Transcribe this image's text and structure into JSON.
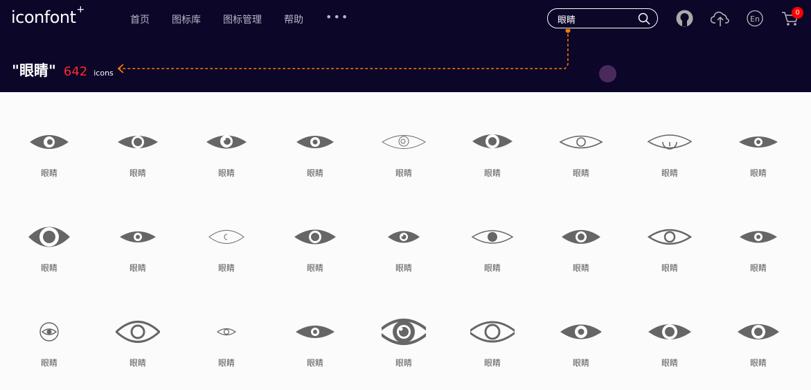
{
  "header": {
    "logo": "iconfont",
    "logo_sup": "+",
    "nav": [
      "首页",
      "图标库",
      "图标管理",
      "帮助"
    ],
    "nav_more": "•••",
    "search_value": "眼睛",
    "cart_count": "0",
    "icons": [
      "github-icon",
      "upload-cloud-icon",
      "language-en-icon",
      "cart-icon",
      "search-icon"
    ]
  },
  "results": {
    "query": "\"眼睛\"",
    "count": "642",
    "unit": "icons"
  },
  "colors": {
    "header_bg": "#0c0628",
    "accent": "#ff2a2a",
    "icon_gray": "#666666",
    "annotation": "#ff7a00"
  },
  "icon_grid": {
    "items": [
      {
        "label": "眼睛",
        "icon": "eye-icon"
      },
      {
        "label": "眼睛",
        "icon": "eye-icon"
      },
      {
        "label": "眼睛",
        "icon": "eye-icon"
      },
      {
        "label": "眼睛",
        "icon": "eye-icon"
      },
      {
        "label": "眼睛",
        "icon": "eye-icon"
      },
      {
        "label": "眼睛",
        "icon": "eye-icon"
      },
      {
        "label": "眼睛",
        "icon": "eye-icon"
      },
      {
        "label": "眼睛",
        "icon": "eye-icon"
      },
      {
        "label": "眼睛",
        "icon": "eye-icon"
      },
      {
        "label": "眼睛",
        "icon": "eye-icon"
      },
      {
        "label": "眼睛",
        "icon": "eye-icon"
      },
      {
        "label": "眼睛",
        "icon": "eye-icon"
      },
      {
        "label": "眼睛",
        "icon": "eye-icon"
      },
      {
        "label": "眼睛",
        "icon": "eye-icon"
      },
      {
        "label": "眼睛",
        "icon": "eye-icon"
      },
      {
        "label": "眼睛",
        "icon": "eye-icon"
      },
      {
        "label": "眼睛",
        "icon": "eye-icon"
      },
      {
        "label": "眼睛",
        "icon": "eye-icon"
      },
      {
        "label": "眼睛",
        "icon": "eye-icon"
      },
      {
        "label": "眼睛",
        "icon": "eye-icon"
      },
      {
        "label": "眼睛",
        "icon": "eye-icon"
      },
      {
        "label": "眼睛",
        "icon": "eye-icon"
      },
      {
        "label": "眼睛",
        "icon": "eye-icon"
      },
      {
        "label": "眼睛",
        "icon": "eye-icon"
      },
      {
        "label": "眼睛",
        "icon": "eye-icon"
      },
      {
        "label": "眼睛",
        "icon": "eye-icon"
      },
      {
        "label": "眼睛",
        "icon": "eye-icon"
      }
    ]
  }
}
